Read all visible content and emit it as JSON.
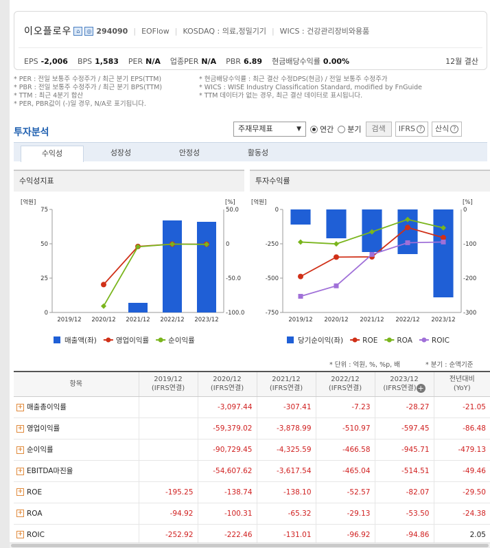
{
  "header": {
    "name": "이오플로우",
    "icon1": "building-icon",
    "icon2": "chart-icon",
    "code": "294090",
    "ename": "EOFlow",
    "market": "KOSDAQ : 의료,정밀기기",
    "wics": "WICS : 건강관리장비와용품",
    "metrics": [
      {
        "label": "EPS",
        "value": "-2,006"
      },
      {
        "label": "BPS",
        "value": "1,583"
      },
      {
        "label": "PER",
        "value": "N/A"
      },
      {
        "label": "업종PER",
        "value": "N/A"
      },
      {
        "label": "PBR",
        "value": "6.89"
      },
      {
        "label": "현금배당수익률",
        "value": "0.00%"
      }
    ],
    "fiscal": "12월 결산"
  },
  "notes": {
    "left": [
      "* PER : 전일 보통주 수정주가 / 최근 분기 EPS(TTM)",
      "* PBR : 전일 보통주 수정주가 / 최근 분기 BPS(TTM)",
      "* TTM : 최근 4분기 합산",
      "* PER, PBR값이 (-)일 경우, N/A로 표기됩니다."
    ],
    "right": [
      "* 현금배당수익률 : 최근 결산 수정DPS(현금) / 전일 보통주 수정주가",
      "* WICS : WISE Industry Classification Standard, modified by FnGuide",
      "* TTM 데이터가 없는 경우, 최근 결산 데이터로 표시됩니다."
    ]
  },
  "section": {
    "title": "투자분석",
    "select_value": "주재무제표",
    "radio_annual": "연간",
    "radio_quarter": "분기",
    "search_btn": "검색",
    "ifrs_btn": "IFRS",
    "formula_btn": "산식"
  },
  "tabs": [
    "수익성",
    "성장성",
    "안정성",
    "활동성"
  ],
  "unit_note_left": "* 단위 : 억원, %, %p, 배",
  "unit_note_right": "* 분기 : 순액기준",
  "charts": {
    "left_title": "수익성지표",
    "right_title": "투자수익률"
  },
  "chart_data": [
    {
      "type": "bar",
      "title": "수익성지표",
      "categories": [
        "2019/12",
        "2020/12",
        "2021/12",
        "2022/12",
        "2023/12"
      ],
      "y_left_unit": "[억원]",
      "y_right_unit": "[%]",
      "y_left_ticks": [
        "75",
        "50",
        "25",
        "0"
      ],
      "y_right_ticks": [
        "50.0",
        "0",
        "-50.0",
        "-100.0"
      ],
      "ylim_left": [
        0,
        75
      ],
      "ylim_right": [
        -100,
        50
      ],
      "series": [
        {
          "name": "매출액(좌)",
          "kind": "bar",
          "axis": "left",
          "color": "#1f5fd6",
          "values": [
            null,
            null,
            7,
            67,
            66
          ]
        },
        {
          "name": "영업이익률",
          "kind": "line",
          "axis": "right",
          "color": "#d03018",
          "values": [
            null,
            -59.4,
            -3.9,
            -0.5,
            -0.6
          ]
        },
        {
          "name": "순이익률",
          "kind": "line",
          "axis": "right",
          "color": "#7ab51d",
          "values": [
            null,
            -90.7,
            -4.3,
            -0.5,
            -0.9
          ]
        }
      ],
      "legend": "bottom"
    },
    {
      "type": "bar",
      "title": "투자수익률",
      "categories": [
        "2019/12",
        "2020/12",
        "2021/12",
        "2022/12",
        "2023/12"
      ],
      "y_left_unit": "[억원]",
      "y_right_unit": "[%]",
      "y_left_ticks": [
        "0",
        "-250",
        "-500",
        "-750"
      ],
      "y_right_ticks": [
        "0",
        "-100",
        "-200",
        "-300"
      ],
      "ylim_left": [
        -750,
        0
      ],
      "ylim_right": [
        -300,
        0
      ],
      "series": [
        {
          "name": "당기순이익(좌)",
          "kind": "bar",
          "axis": "left",
          "color": "#1f5fd6",
          "values": [
            -110,
            -210,
            -310,
            -325,
            -640
          ]
        },
        {
          "name": "ROE",
          "kind": "line",
          "axis": "right",
          "color": "#d03018",
          "values": [
            -195.25,
            -138.74,
            -138.1,
            -52.57,
            -82.07
          ]
        },
        {
          "name": "ROA",
          "kind": "line",
          "axis": "right",
          "color": "#7ab51d",
          "values": [
            -94.92,
            -100.31,
            -65.32,
            -29.13,
            -53.5
          ]
        },
        {
          "name": "ROIC",
          "kind": "line",
          "axis": "right",
          "color": "#a070d8",
          "values": [
            -252.92,
            -222.46,
            -131.01,
            -96.92,
            -94.86
          ]
        }
      ],
      "legend": "bottom"
    }
  ],
  "table": {
    "headers": [
      "항목",
      "2019/12\n(IFRS연결)",
      "2020/12\n(IFRS연결)",
      "2021/12\n(IFRS연결)",
      "2022/12\n(IFRS연결)",
      "2023/12\n(IFRS연결)",
      "전년대비\n(YoY)"
    ],
    "rows": [
      [
        "매출총이익률",
        "",
        "-3,097.44",
        "-307.41",
        "-7.23",
        "-28.27",
        "-21.05"
      ],
      [
        "영업이익률",
        "",
        "-59,379.02",
        "-3,878.99",
        "-510.97",
        "-597.45",
        "-86.48"
      ],
      [
        "순이익률",
        "",
        "-90,729.45",
        "-4,325.59",
        "-466.58",
        "-945.71",
        "-479.13"
      ],
      [
        "EBITDA마진율",
        "",
        "-54,607.62",
        "-3,617.54",
        "-465.04",
        "-514.51",
        "-49.46"
      ],
      [
        "ROE",
        "-195.25",
        "-138.74",
        "-138.10",
        "-52.57",
        "-82.07",
        "-29.50"
      ],
      [
        "ROA",
        "-94.92",
        "-100.31",
        "-65.32",
        "-29.13",
        "-53.50",
        "-24.38"
      ],
      [
        "ROIC",
        "-252.92",
        "-222.46",
        "-131.01",
        "-96.92",
        "-94.86",
        "2.05"
      ]
    ]
  }
}
